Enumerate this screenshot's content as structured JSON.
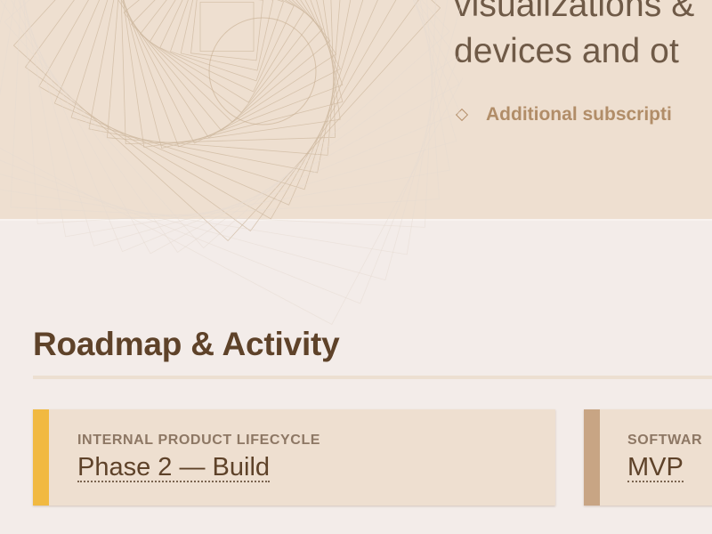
{
  "hero": {
    "line_1": "visualizations &",
    "line_2": "devices and ot",
    "bullet_text": "Additional subscripti"
  },
  "section": {
    "title": "Roadmap & Activity"
  },
  "cards": [
    {
      "label": "INTERNAL PRODUCT LIFECYCLE",
      "value": "Phase 2 — Build",
      "accent_color": "#f1b941"
    },
    {
      "label": "SOFTWAR",
      "value": "MVP",
      "accent_color": "#c8a584"
    }
  ],
  "colors": {
    "hero_background": "#eedfd0",
    "page_background": "#f3ece9",
    "heading_brown": "#5e4229",
    "muted_brown": "#8d7764"
  },
  "icons": {
    "bullet": "diamond-icon",
    "decor": "spiral-pattern"
  }
}
